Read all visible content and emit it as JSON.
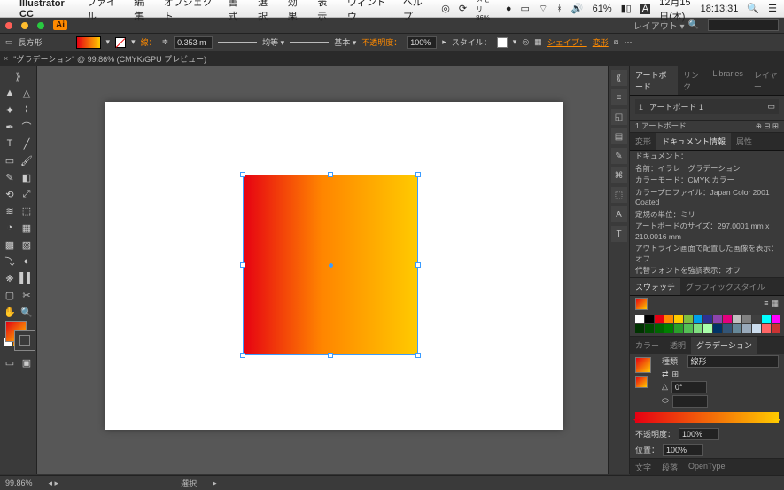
{
  "menubar": {
    "app": "Illustrator CC",
    "items": [
      "ファイル",
      "編集",
      "オブジェクト",
      "書式",
      "選択",
      "効果",
      "表示",
      "ウィンドウ",
      "ヘルプ"
    ],
    "battery": "61%",
    "date": "12月15日(木)",
    "time": "18:13:31",
    "mem": "メモリ 86%"
  },
  "appbar": {
    "badge": "Ai",
    "layout": "レイアウト ▾"
  },
  "ctrl": {
    "shape": "長方形",
    "stroke_lbl": "線：",
    "stroke_w": "0.353 m",
    "uniform": "均等 ▾",
    "basic": "基本 ▾",
    "opacity_lbl": "不透明度：",
    "opacity": "100%",
    "style_lbl": "スタイル：",
    "shape_link": "シェイプ：",
    "trans_link": "変形"
  },
  "tab": {
    "x": "×",
    "title": "\"グラデーション\" @ 99.86% (CMYK/GPU プレビュー)"
  },
  "right": {
    "tabs_top": [
      "アートボード",
      "リンク",
      "Libraries",
      "レイヤー"
    ],
    "artboard": {
      "num": "1",
      "name": "アートボード 1"
    },
    "ab_footer_num": "1",
    "ab_footer_lbl": "アートボード",
    "tabs_info": [
      "変形",
      "ドキュメント情報",
      "属性"
    ],
    "doc_lbl": "ドキュメント：",
    "info": [
      "名前：イラレ　グラデーション",
      "カラーモード：CMYK カラー",
      "カラープロファイル：Japan Color 2001 Coated",
      "定規の単位：ミリ",
      "アートボードのサイズ：297.0001 mm x 210.0016 mm",
      "アウトライン画面で配置した画像を表示：オフ",
      "代替フォントを強調表示：オフ"
    ],
    "tabs_sw": [
      "スウォッチ",
      "グラフィックスタイル"
    ],
    "tabs_col": [
      "カラー",
      "透明",
      "グラデーション"
    ],
    "grad_type_lbl": "種類",
    "grad_type": "線形",
    "angle": "0°",
    "loc": "",
    "opac_lbl": "不透明度：",
    "opac": "100%",
    "pos_lbl": "位置：",
    "pos": "100%",
    "tabs_txt": [
      "文字",
      "段落",
      "OpenType"
    ]
  },
  "status": {
    "zoom": "99.86%",
    "mid": "選択"
  },
  "swatches": [
    "#fff",
    "#000",
    "#e60012",
    "#ff8a00",
    "#ffcb00",
    "#7fbf3f",
    "#00a0e9",
    "#2e3192",
    "#8e44ad",
    "#e4007f",
    "#c0c0c0",
    "#808080",
    "#404040",
    "#00ffff",
    "#ff00ff",
    "#003300",
    "#004c00",
    "#006600",
    "#008000",
    "#2aa02a",
    "#55bf55",
    "#80df80",
    "#aaffaa",
    "#003366",
    "#335577",
    "#668899",
    "#99aabb",
    "#ccddee",
    "#ff6666",
    "#cc3333"
  ],
  "chart_data": {
    "type": "gradient",
    "direction": "horizontal",
    "stops": [
      {
        "offset": 0,
        "color": "#e60012"
      },
      {
        "offset": 1,
        "color": "#ffcb00"
      }
    ],
    "rect_mm": {
      "w": 139,
      "h": 143
    }
  }
}
